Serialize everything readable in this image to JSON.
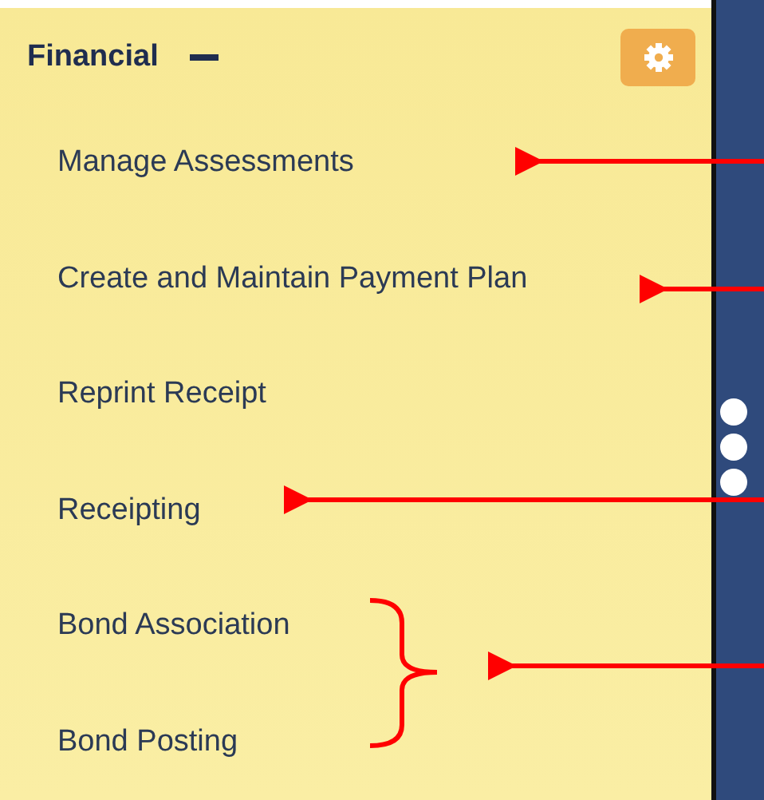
{
  "section": {
    "title": "Financial",
    "expanded": true
  },
  "items": [
    {
      "label": "Manage Assessments"
    },
    {
      "label": "Create and Maintain Payment Plan"
    },
    {
      "label": "Reprint Receipt"
    },
    {
      "label": "Receipting"
    },
    {
      "label": "Bond Association"
    },
    {
      "label": "Bond Posting"
    }
  ]
}
